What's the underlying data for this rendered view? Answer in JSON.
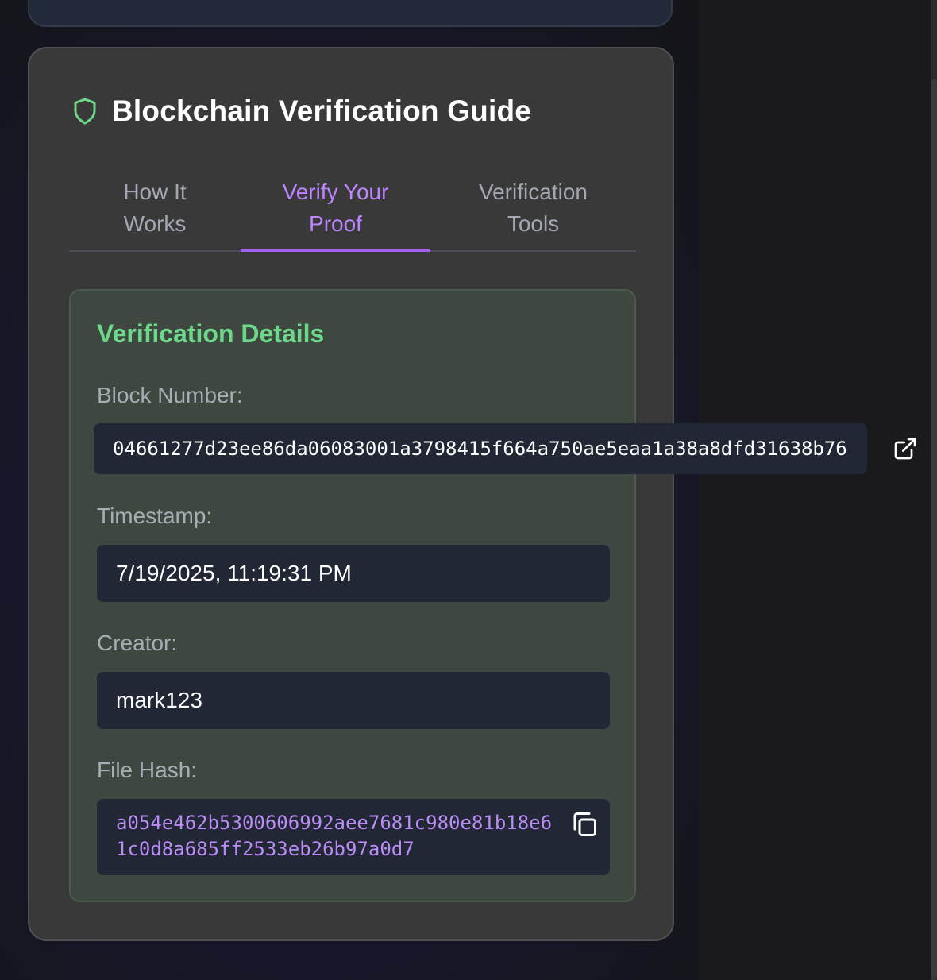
{
  "guide": {
    "title": "Blockchain Verification Guide",
    "icon": "shield-icon",
    "tabs": [
      {
        "line1": "How It",
        "line2": "Works",
        "active": false
      },
      {
        "line1": "Verify Your",
        "line2": "Proof",
        "active": true
      },
      {
        "line1": "Verification",
        "line2": "Tools",
        "active": false
      }
    ]
  },
  "details": {
    "title": "Verification Details",
    "block_label": "Block Number:",
    "block_value": "04661277d23ee86da06083001a3798415f664a750ae5eaa1a38a8dfd31638b76",
    "timestamp_label": "Timestamp:",
    "timestamp_value": "7/19/2025, 11:19:31 PM",
    "creator_label": "Creator:",
    "creator_value": "mark123",
    "hash_label": "File Hash:",
    "hash_value": "a054e462b5300606992aee7681c980e81b18e61c0d8a685ff2533eb26b97a0d7"
  },
  "colors": {
    "accent": "#a462f0",
    "success": "#6ed88a",
    "card_bg": "#393939",
    "field_bg": "#212735"
  }
}
